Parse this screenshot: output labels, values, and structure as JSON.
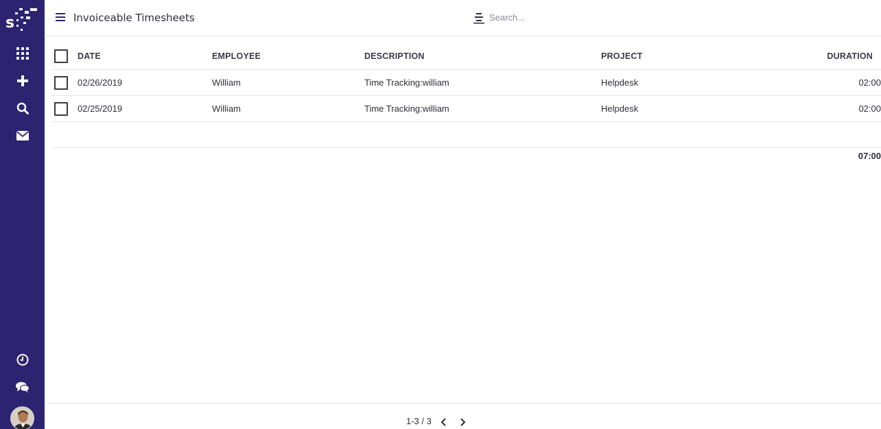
{
  "app": {
    "brand_color": "#2c2471",
    "logo_icon": "sentrifugo-logo"
  },
  "sidebar": {
    "items": [
      {
        "name": "apps-grid-icon"
      },
      {
        "name": "plus-icon"
      },
      {
        "name": "search-icon"
      },
      {
        "name": "mail-icon"
      }
    ],
    "bottom_items": [
      {
        "name": "clock-icon"
      },
      {
        "name": "chat-icon"
      }
    ]
  },
  "header": {
    "title": "Invoiceable Timesheets",
    "search_placeholder": "Search..."
  },
  "table": {
    "columns": [
      "DATE",
      "EMPLOYEE",
      "DESCRIPTION",
      "PROJECT",
      "DURATION"
    ],
    "rows": [
      {
        "date": "02/26/2019",
        "employee": "William",
        "description": "Time Tracking:william",
        "project": "Helpdesk",
        "duration": "02:00"
      },
      {
        "date": "02/25/2019",
        "employee": "William",
        "description": "Time Tracking:william",
        "project": "Helpdesk",
        "duration": "02:00"
      }
    ],
    "total_duration": "07:00"
  },
  "footer": {
    "pager": "1-3 / 3"
  }
}
